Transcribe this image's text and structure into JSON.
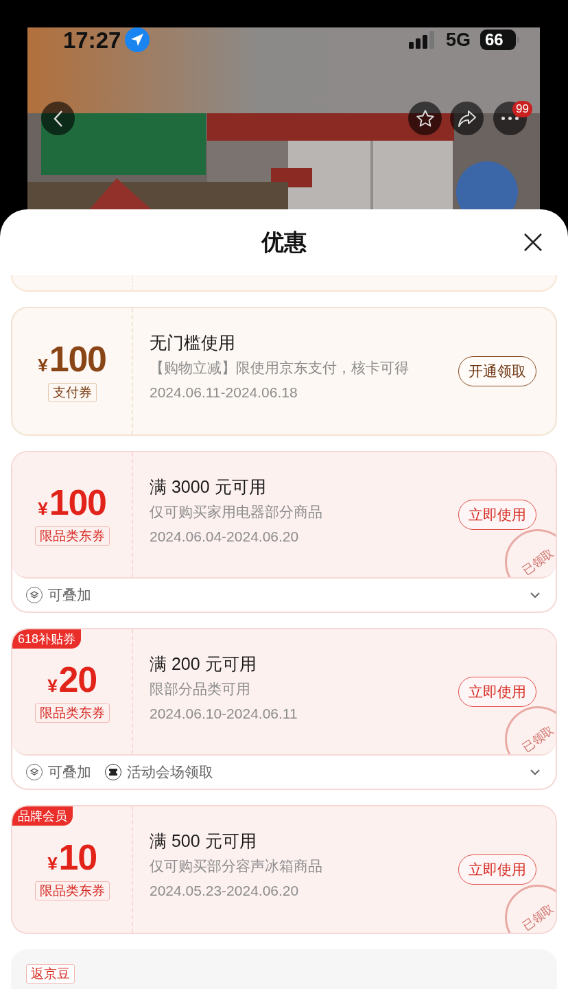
{
  "status_bar": {
    "time": "17:27",
    "network": "5G",
    "battery": "66"
  },
  "top_bar": {
    "more_badge": "99"
  },
  "header": {
    "title": "优惠"
  },
  "list": {
    "clipped_card_above": true
  },
  "coupons": [
    {
      "kind": "payment",
      "currency": "¥",
      "amount": "100",
      "type_label": "支付券",
      "title": "无门槛使用",
      "description": "【购物立减】限使用京东支付，核卡可得",
      "dates": "2024.06.11-2024.06.18",
      "action": "开通领取",
      "claimed": false
    },
    {
      "kind": "jd",
      "currency": "¥",
      "amount": "100",
      "type_label": "限品类东券",
      "title": "满 3000 元可用",
      "description": "仅可购买家用电器部分商品",
      "dates": "2024.06.04-2024.06.20",
      "action": "立即使用",
      "claimed": true,
      "stamp": "已领取",
      "footer": {
        "expanded": false,
        "features": [
          {
            "kind": "stack",
            "label": "可叠加"
          }
        ]
      }
    },
    {
      "kind": "jd",
      "tag": "618补贴券",
      "currency": "¥",
      "amount": "20",
      "type_label": "限品类东券",
      "title": "满 200 元可用",
      "description": "限部分品类可用",
      "dates": "2024.06.10-2024.06.11",
      "action": "立即使用",
      "claimed": true,
      "stamp": "已领取",
      "footer": {
        "expanded": false,
        "features": [
          {
            "kind": "stack",
            "label": "可叠加"
          },
          {
            "kind": "venue",
            "label": "活动会场领取"
          }
        ]
      }
    },
    {
      "kind": "jd",
      "tag": "品牌会员",
      "currency": "¥",
      "amount": "10",
      "type_label": "限品类东券",
      "title": "满 500 元可用",
      "description": "仅可购买部分容声冰箱商品",
      "dates": "2024.05.23-2024.06.20",
      "action": "立即使用",
      "claimed": true,
      "stamp": "已领取"
    }
  ],
  "clipped_card_below": {
    "type_label": "返京豆"
  }
}
